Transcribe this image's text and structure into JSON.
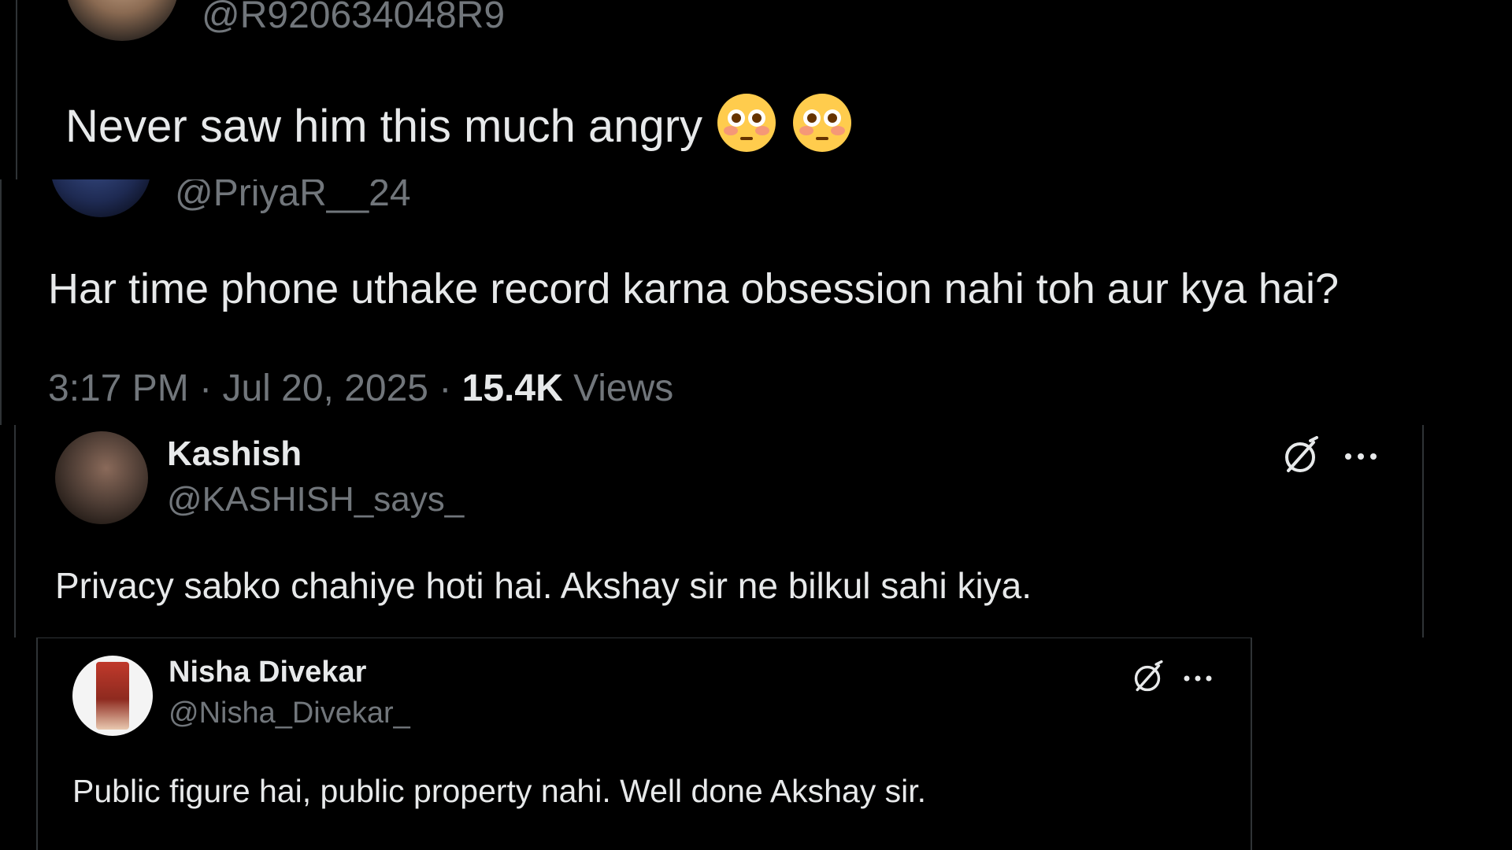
{
  "tweet1": {
    "handle": "@R920634048R9",
    "text": "Never saw him this much angry",
    "emoji": "flushed-face-emoji"
  },
  "tweet2": {
    "handle": "@PriyaR__24",
    "text": "Har time phone uthake record karna obsession nahi toh aur kya hai?",
    "time": "3:17 PM",
    "sep1": "·",
    "date": "Jul 20, 2025",
    "sep2": "·",
    "views_count": "15.4K",
    "views_label": "Views"
  },
  "reply1": {
    "name": "Kashish",
    "handle": "@KASHISH_says_",
    "text": "Privacy sabko chahiye hoti hai. Akshay sir ne bilkul sahi kiya."
  },
  "reply2": {
    "name": "Nisha Divekar",
    "handle": "@Nisha_Divekar_",
    "text": "Public figure hai, public property nahi. Well done Akshay sir."
  },
  "colors": {
    "background": "#000000",
    "primary_text": "#e7e9ea",
    "secondary_text": "#71767b",
    "border": "#2f3336"
  },
  "icons": {
    "grok": "grok-icon",
    "more": "more-dots-icon"
  }
}
